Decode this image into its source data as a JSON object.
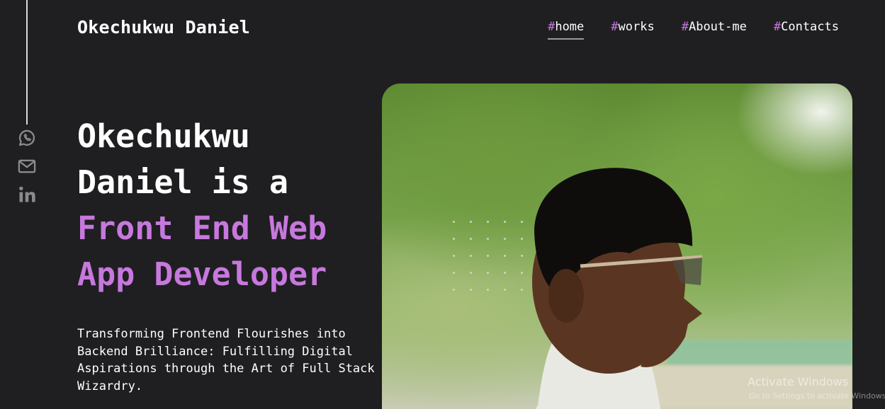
{
  "header": {
    "logo": "Okechukwu Daniel",
    "nav": [
      {
        "hash": "#",
        "label": "home",
        "active": true
      },
      {
        "hash": "#",
        "label": "works",
        "active": false
      },
      {
        "hash": "#",
        "label": "About-me",
        "active": false
      },
      {
        "hash": "#",
        "label": "Contacts",
        "active": false
      }
    ]
  },
  "social": {
    "icons": [
      "whatsapp-icon",
      "mail-icon",
      "linkedin-icon"
    ]
  },
  "hero": {
    "title_line1": "Okechukwu",
    "title_line2": "Daniel is a",
    "title_highlight1": "Front End Web",
    "title_highlight2": "App Developer",
    "subtitle": "Transforming Frontend Flourishes into Backend Brilliance: Fulfilling Digital Aspirations through the Art of Full Stack Wizardry."
  },
  "system": {
    "watermark": "Activate Windows",
    "watermark_sub": "Go to Settings to activate Windows."
  },
  "colors": {
    "accent": "#c778dd",
    "background": "#1f1f21",
    "text": "#ffffff",
    "muted": "#8a8a8a"
  }
}
